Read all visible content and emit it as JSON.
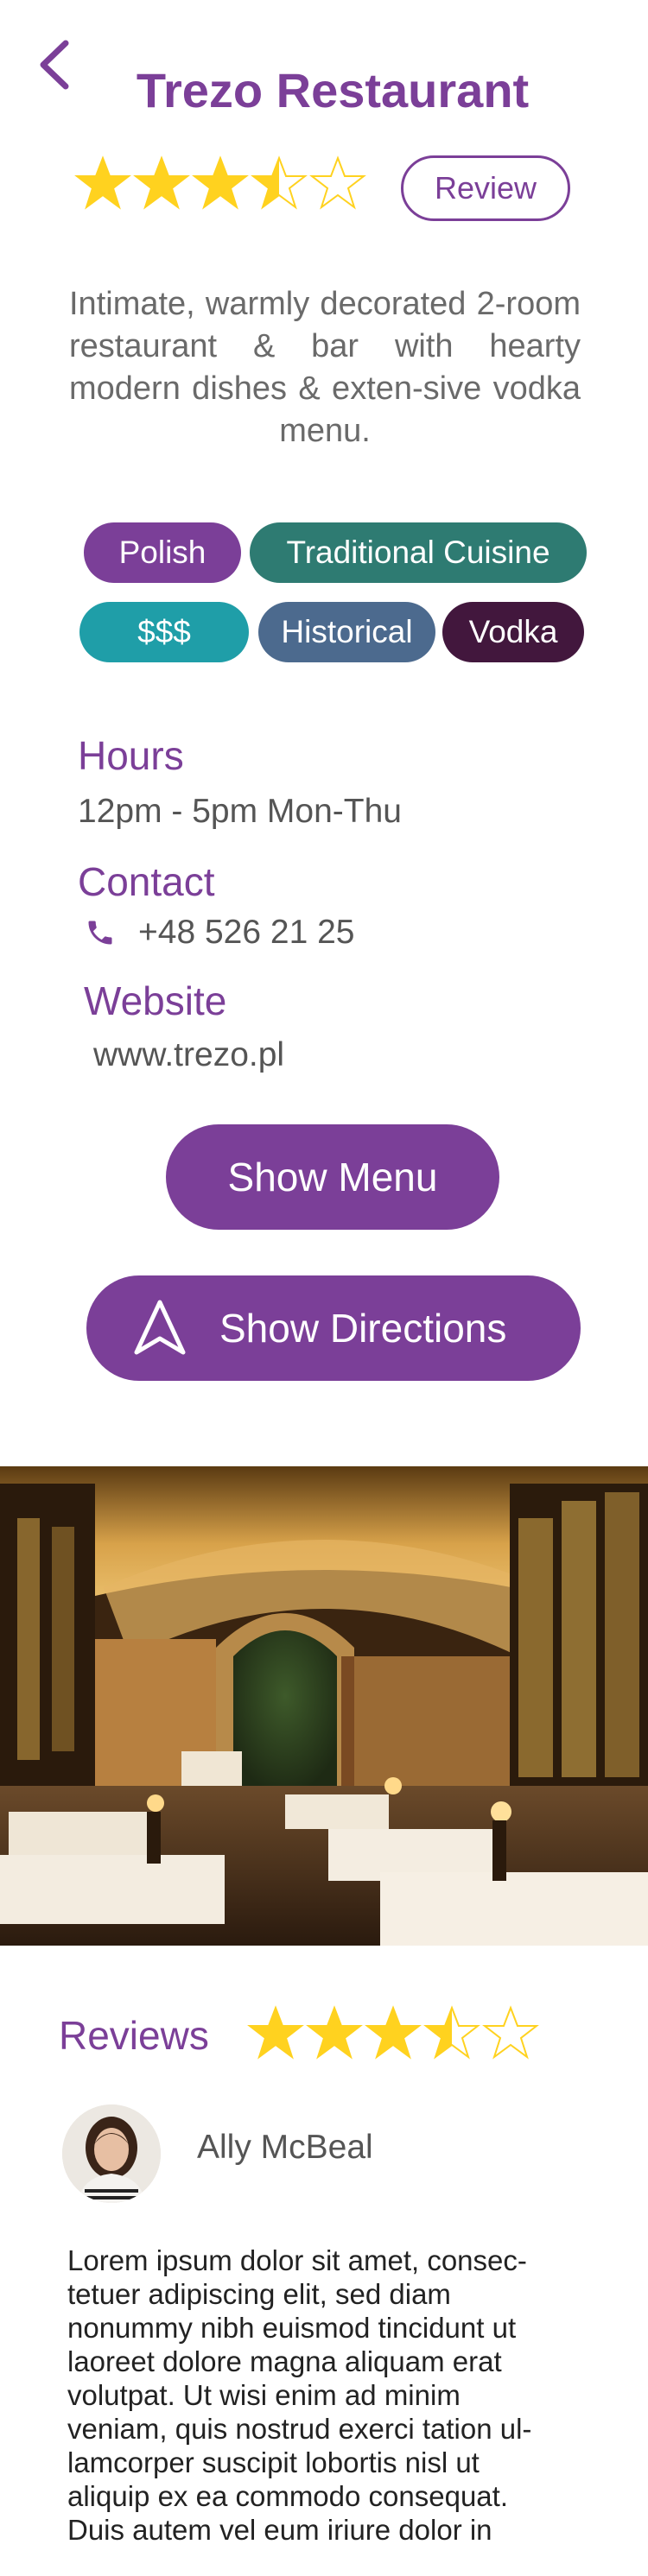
{
  "header": {
    "title": "Trezo Restaurant"
  },
  "rating": {
    "value": 3.5,
    "max": 5,
    "star_color": "#ffd21f"
  },
  "review_button": {
    "label": "Review"
  },
  "description": "Intimate, warmly decorated 2-room restaurant & bar with hearty modern dishes & exten-sive vodka menu.",
  "tags": [
    {
      "label": "Polish",
      "color": "#7b3f98"
    },
    {
      "label": "Traditional Cuisine",
      "color": "#2e7b72"
    },
    {
      "label": "$$$",
      "color": "#1f9ea8"
    },
    {
      "label": "Historical",
      "color": "#4c6a8e"
    },
    {
      "label": "Vodka",
      "color": "#42173d"
    }
  ],
  "hours": {
    "heading": "Hours",
    "value": "12pm - 5pm Mon-Thu"
  },
  "contact": {
    "heading": "Contact",
    "phone": "+48 526 21 25",
    "icon": "phone-icon"
  },
  "website": {
    "heading": "Website",
    "url": "www.trezo.pl"
  },
  "buttons": {
    "menu": "Show Menu",
    "directions": "Show Directions",
    "directions_icon": "navigation-arrow-icon"
  },
  "reviews": {
    "heading": "Reviews",
    "rating": 3.5,
    "items": [
      {
        "author": "Ally McBeal",
        "text": "Lorem ipsum dolor sit amet, consec-tetuer adipiscing elit, sed diam nonummy nibh euismod tincidunt ut laoreet dolore magna aliquam erat volutpat. Ut wisi enim ad minim veniam, quis nostrud exerci tation ul-lamcorper suscipit lobortis nisl ut aliquip ex ea commodo consequat. Duis autem vel eum iriure dolor in"
      }
    ]
  },
  "accent_color": "#7b3f98"
}
